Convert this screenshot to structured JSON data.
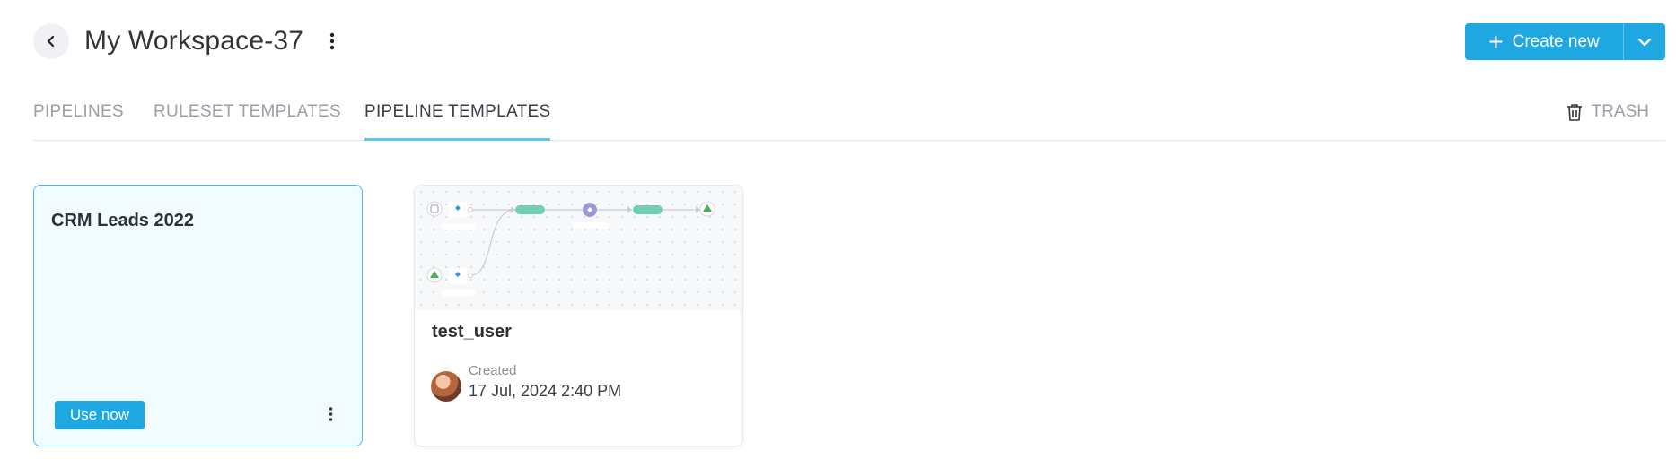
{
  "header": {
    "title": "My Workspace-37",
    "create_label": "Create new"
  },
  "tabs": [
    {
      "label": "PIPELINES",
      "active": false
    },
    {
      "label": "RULESET TEMPLATES",
      "active": false
    },
    {
      "label": "PIPELINE TEMPLATES",
      "active": true
    }
  ],
  "trash_label": "TRASH",
  "cards": [
    {
      "title": "CRM Leads 2022",
      "action_label": "Use now"
    },
    {
      "title": "test_user",
      "created_label": "Created",
      "created_date": "17 Jul, 2024 2:40 PM"
    }
  ],
  "colors": {
    "accent": "#1ea7e1",
    "tab_underline": "#64c3ec",
    "card_selected_bg": "#f2fbff",
    "node_green": "#6fd0b3",
    "node_purple": "#9b98d6"
  },
  "icons": {
    "back": "chevron-left-icon",
    "menu": "kebab-icon",
    "create": "plus-icon",
    "dropdown": "chevron-down-icon",
    "trash": "trash-icon"
  }
}
